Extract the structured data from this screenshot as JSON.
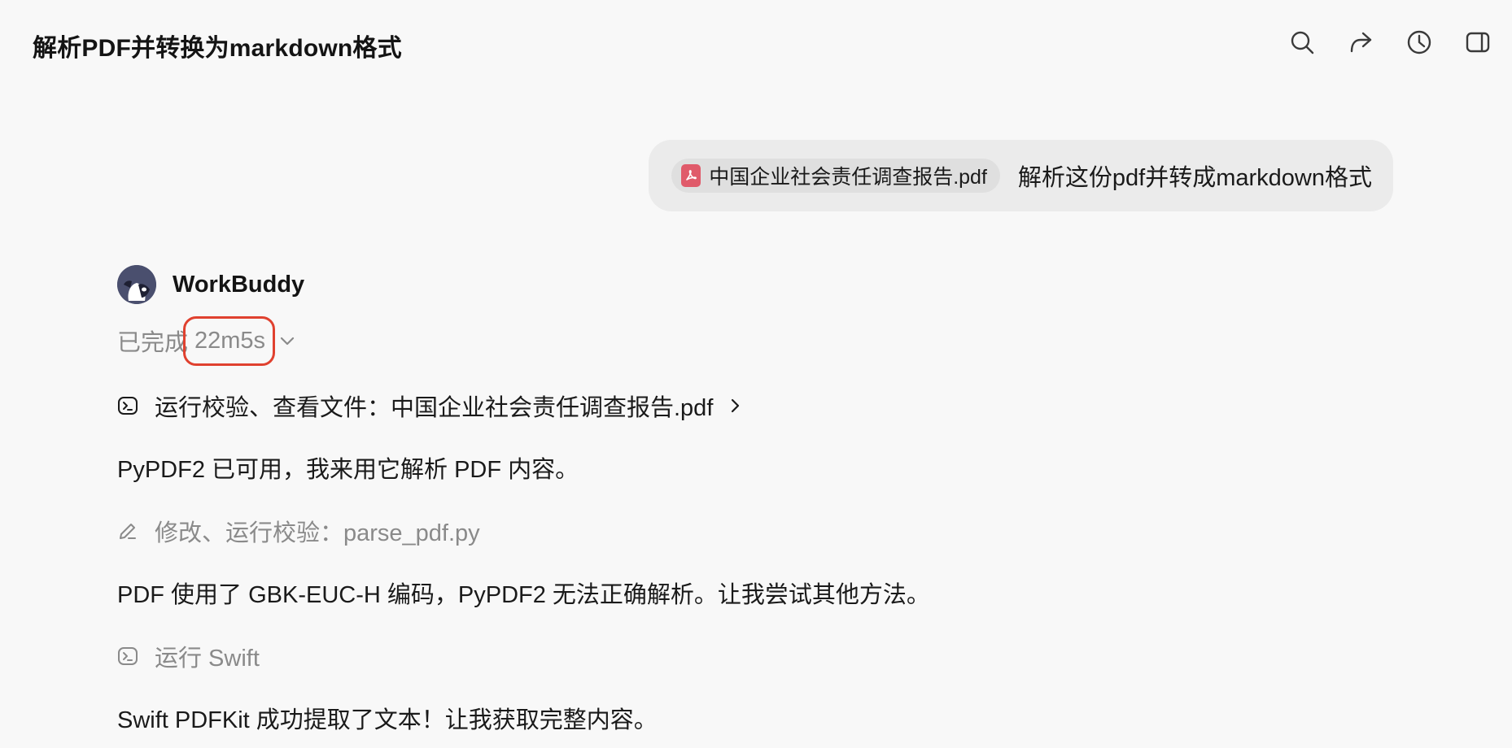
{
  "header": {
    "title": "解析PDF并转换为markdown格式",
    "toolbar": [
      {
        "icon": "search-icon"
      },
      {
        "icon": "share-icon"
      },
      {
        "icon": "history-icon"
      },
      {
        "icon": "sidebar-toggle-icon"
      }
    ]
  },
  "user_message": {
    "attachment": {
      "icon": "pdf-file-icon",
      "name": "中国企业社会责任调查报告.pdf"
    },
    "text": "解析这份pdf并转成markdown格式"
  },
  "assistant": {
    "name": "WorkBuddy",
    "status_label": "已完成",
    "duration": "22m5s",
    "highlight_color": "#e0412f",
    "steps": [
      {
        "icon": "terminal-icon",
        "text": "运行校验、查看文件：中国企业社会责任调查报告.pdf"
      },
      {
        "icon": "pencil-icon",
        "text": "修改、运行校验：parse_pdf.py"
      },
      {
        "icon": "terminal-icon",
        "text": "运行 Swift"
      }
    ],
    "paragraphs": [
      "PyPDF2 已可用，我来用它解析 PDF 内容。",
      "PDF 使用了 GBK-EUC-H 编码，PyPDF2 无法正确解析。让我尝试其他方法。",
      "Swift PDFKit 成功提取了文本！让我获取完整内容。"
    ]
  }
}
